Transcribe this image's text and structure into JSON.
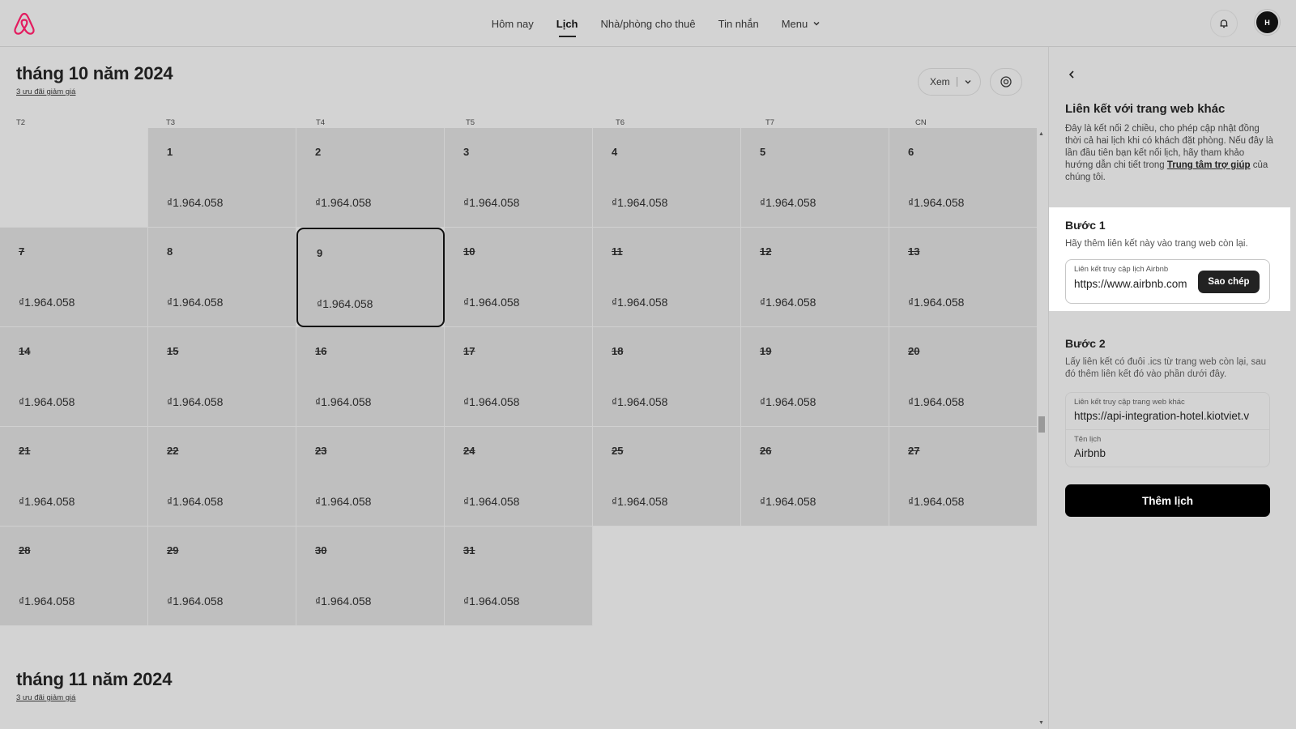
{
  "header": {
    "nav": [
      {
        "label": "Hôm nay",
        "active": false
      },
      {
        "label": "Lịch",
        "active": true
      },
      {
        "label": "Nhà/phòng cho thuê",
        "active": false
      },
      {
        "label": "Tin nhắn",
        "active": false
      },
      {
        "label": "Menu",
        "active": false
      }
    ],
    "avatar_initial": "H",
    "icons": {
      "logo": "airbnb-logo-icon",
      "bell": "bell-icon",
      "menu_chevron": "chevron-down-icon"
    }
  },
  "calendar": {
    "october": {
      "title": "tháng 10 năm 2024",
      "discount_link": "3 ưu đãi giảm giá"
    },
    "november": {
      "title": "tháng 11 năm 2024",
      "discount_link": "3 ưu đãi giảm giá"
    },
    "view_button": "Xem",
    "weekdays": [
      "T2",
      "T3",
      "T4",
      "T5",
      "T6",
      "T7",
      "CN"
    ],
    "price": "₫1.964.058",
    "days": [
      "1",
      "2",
      "3",
      "4",
      "5",
      "6",
      "7",
      "8",
      "9",
      "10",
      "11",
      "12",
      "13",
      "14",
      "15",
      "16",
      "17",
      "18",
      "19",
      "20",
      "21",
      "22",
      "23",
      "24",
      "25",
      "26",
      "27",
      "28",
      "29",
      "30",
      "31"
    ],
    "selected_day": "9"
  },
  "panel": {
    "title": "Liên kết với trang web khác",
    "description_before": "Đây là kết nối 2 chiều, cho phép cập nhật đồng thời cả hai lịch khi có khách đặt phòng. Nếu đây là lần đầu tiên bạn kết nối lịch, hãy tham khảo hướng dẫn chi tiết trong ",
    "description_link": "Trung tâm trợ giúp",
    "description_after": " của chúng tôi.",
    "step1": {
      "title": "Bước 1",
      "subtitle": "Hãy thêm liên kết này vào trang web còn lại.",
      "field_label": "Liên kết truy cập lịch Airbnb",
      "field_value": "https://www.airbnb.com",
      "copy_button": "Sao chép"
    },
    "step2": {
      "title": "Bước 2",
      "subtitle": "Lấy liên kết có đuôi .ics từ trang web còn lại, sau đó thêm liên kết đó vào phần dưới đây.",
      "url_label": "Liên kết truy cập trang web khác",
      "url_value": "https://api-integration-hotel.kiotviet.v",
      "name_label": "Tên lịch",
      "name_value": "Airbnb"
    },
    "add_button": "Thêm lịch"
  }
}
